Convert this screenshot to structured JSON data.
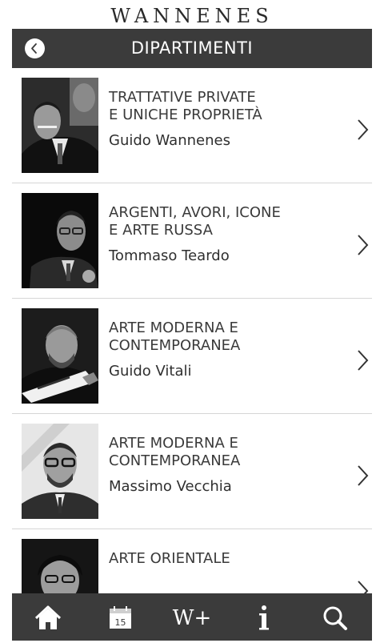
{
  "app": {
    "logo": "WANNENES"
  },
  "header": {
    "title": "DIPARTIMENTI",
    "back_icon": "chevron-left-icon"
  },
  "departments": [
    {
      "department": "TRATTATIVE PRIVATE E UNICHE PROPRIETÀ",
      "line1": "TRATTATIVE PRIVATE",
      "line2": "E UNICHE PROPRIETÀ",
      "name": "Guido Wannenes"
    },
    {
      "department": "ARGENTI, AVORI, ICONE E ARTE RUSSA",
      "line1": "ARGENTI, AVORI, ICONE",
      "line2": "E ARTE RUSSA",
      "name": "Tommaso Teardo"
    },
    {
      "department": "ARTE MODERNA E CONTEMPORANEA",
      "line1": "ARTE MODERNA E",
      "line2": "CONTEMPORANEA",
      "name": "Guido Vitali"
    },
    {
      "department": "ARTE MODERNA E CONTEMPORANEA",
      "line1": "ARTE MODERNA E",
      "line2": "CONTEMPORANEA",
      "name": "Massimo Vecchia"
    },
    {
      "department": "ARTE ORIENTALE",
      "line1": "ARTE ORIENTALE",
      "line2": "",
      "name": ""
    }
  ],
  "tabbar": {
    "calendar_day": "15",
    "wplus_label": "W+",
    "icons": [
      "home-icon",
      "calendar-icon",
      "w-plus-icon",
      "info-icon",
      "search-icon"
    ]
  },
  "colors": {
    "bar": "#3b3b3b",
    "text": "#3a3a3a",
    "divider": "#d6d6d6"
  }
}
